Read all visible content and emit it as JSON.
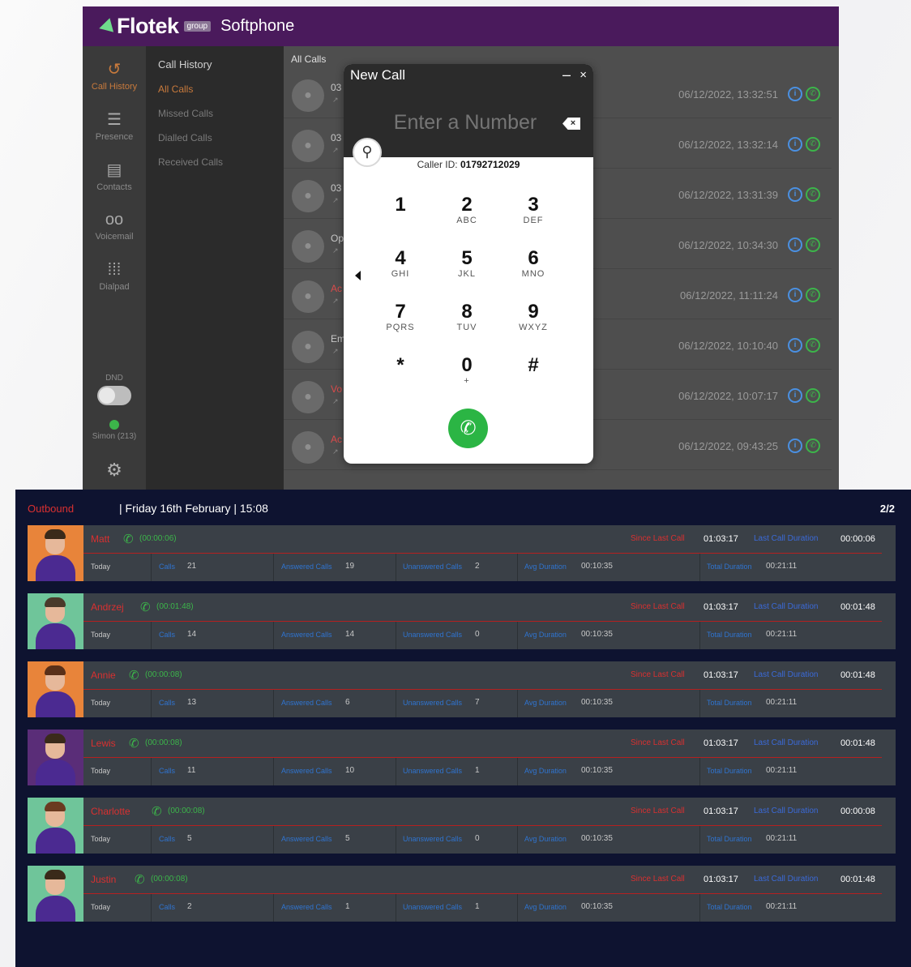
{
  "softphone": {
    "logo": "Flotek",
    "logo_badge": "group",
    "app_name": "Softphone",
    "rail": [
      {
        "label": "Call History",
        "icon": "history-icon"
      },
      {
        "label": "Presence",
        "icon": "traffic-light-icon"
      },
      {
        "label": "Contacts",
        "icon": "contacts-book-icon"
      },
      {
        "label": "Voicemail",
        "icon": "voicemail-icon"
      },
      {
        "label": "Dialpad",
        "icon": "dialpad-icon"
      }
    ],
    "dnd_label": "DND",
    "user_status": "Simon (213)",
    "subnav": {
      "title": "Call History",
      "items": [
        "All Calls",
        "Missed Calls",
        "Dialled Calls",
        "Received Calls"
      ]
    },
    "list_title": "All Calls",
    "calls": [
      {
        "name": "03",
        "date": "06/12/2022, 13:32:51",
        "red": false
      },
      {
        "name": "03",
        "date": "06/12/2022, 13:32:14",
        "red": false
      },
      {
        "name": "03",
        "date": "06/12/2022, 13:31:39",
        "red": false
      },
      {
        "name": "Op",
        "date": "06/12/2022, 10:34:30",
        "red": false
      },
      {
        "name": "Ac",
        "date": "06/12/2022, 11:11:24",
        "red": true
      },
      {
        "name": "Em",
        "date": "06/12/2022, 10:10:40",
        "red": false
      },
      {
        "name": "Vo",
        "date": "06/12/2022, 10:07:17",
        "red": true
      },
      {
        "name": "Ac",
        "date": "06/12/2022, 09:43:25",
        "red": true
      }
    ],
    "accent": "#c87a3c"
  },
  "new_call": {
    "title": "New Call",
    "minimize": "–",
    "close": "×",
    "input_placeholder": "Enter a Number",
    "caller_id_label": "Caller ID:",
    "caller_id_value": "01792712029",
    "keys": [
      {
        "d": "1",
        "l": ""
      },
      {
        "d": "2",
        "l": "ABC"
      },
      {
        "d": "3",
        "l": "DEF"
      },
      {
        "d": "4",
        "l": "GHI"
      },
      {
        "d": "5",
        "l": "JKL"
      },
      {
        "d": "6",
        "l": "MNO"
      },
      {
        "d": "7",
        "l": "PQRS"
      },
      {
        "d": "8",
        "l": "TUV"
      },
      {
        "d": "9",
        "l": "WXYZ"
      },
      {
        "d": "*",
        "l": ""
      },
      {
        "d": "0",
        "l": "+"
      },
      {
        "d": "#",
        "l": ""
      }
    ],
    "call_color": "#2bb544"
  },
  "dashboard": {
    "direction": "Outbound",
    "date": "| Friday 16th February | 15:08",
    "page": "2/2",
    "labels": {
      "today": "Today",
      "calls": "Calls",
      "answered": "Answered Calls",
      "unanswered": "Unanswered Calls",
      "avg": "Avg Duration",
      "total": "Total Duration",
      "since": "Since Last Call",
      "last": "Last Call Duration"
    },
    "agents": [
      {
        "name": "Matt",
        "current": "(00:00:06)",
        "since": "01:03:17",
        "last": "00:00:06",
        "calls": "21",
        "answered": "19",
        "unanswered": "2",
        "avg": "00:10:35",
        "total": "00:21:11",
        "bg": "#e8843a",
        "hair": "#3a2a1a"
      },
      {
        "name": "Andrzej",
        "current": "(00:01:48)",
        "since": "01:03:17",
        "last": "00:01:48",
        "calls": "14",
        "answered": "14",
        "unanswered": "0",
        "avg": "00:10:35",
        "total": "00:21:11",
        "bg": "#6fc59a",
        "hair": "#4a3a2a"
      },
      {
        "name": "Annie",
        "current": "(00:00:08)",
        "since": "01:03:17",
        "last": "00:01:48",
        "calls": "13",
        "answered": "6",
        "unanswered": "7",
        "avg": "00:10:35",
        "total": "00:21:11",
        "bg": "#e8843a",
        "hair": "#5a3018"
      },
      {
        "name": "Lewis",
        "current": "(00:00:08)",
        "since": "01:03:17",
        "last": "00:01:48",
        "calls": "11",
        "answered": "10",
        "unanswered": "1",
        "avg": "00:10:35",
        "total": "00:21:11",
        "bg": "#5a2d78",
        "hair": "#3a2a1a"
      },
      {
        "name": "Charlotte",
        "current": "(00:00:08)",
        "since": "01:03:17",
        "last": "00:00:08",
        "calls": "5",
        "answered": "5",
        "unanswered": "0",
        "avg": "00:10:35",
        "total": "00:21:11",
        "bg": "#6fc59a",
        "hair": "#6a3a20"
      },
      {
        "name": "Justin",
        "current": "(00:00:08)",
        "since": "01:03:17",
        "last": "00:01:48",
        "calls": "2",
        "answered": "1",
        "unanswered": "1",
        "avg": "00:10:35",
        "total": "00:21:11",
        "bg": "#6fc59a",
        "hair": "#3a2a1a"
      }
    ]
  }
}
